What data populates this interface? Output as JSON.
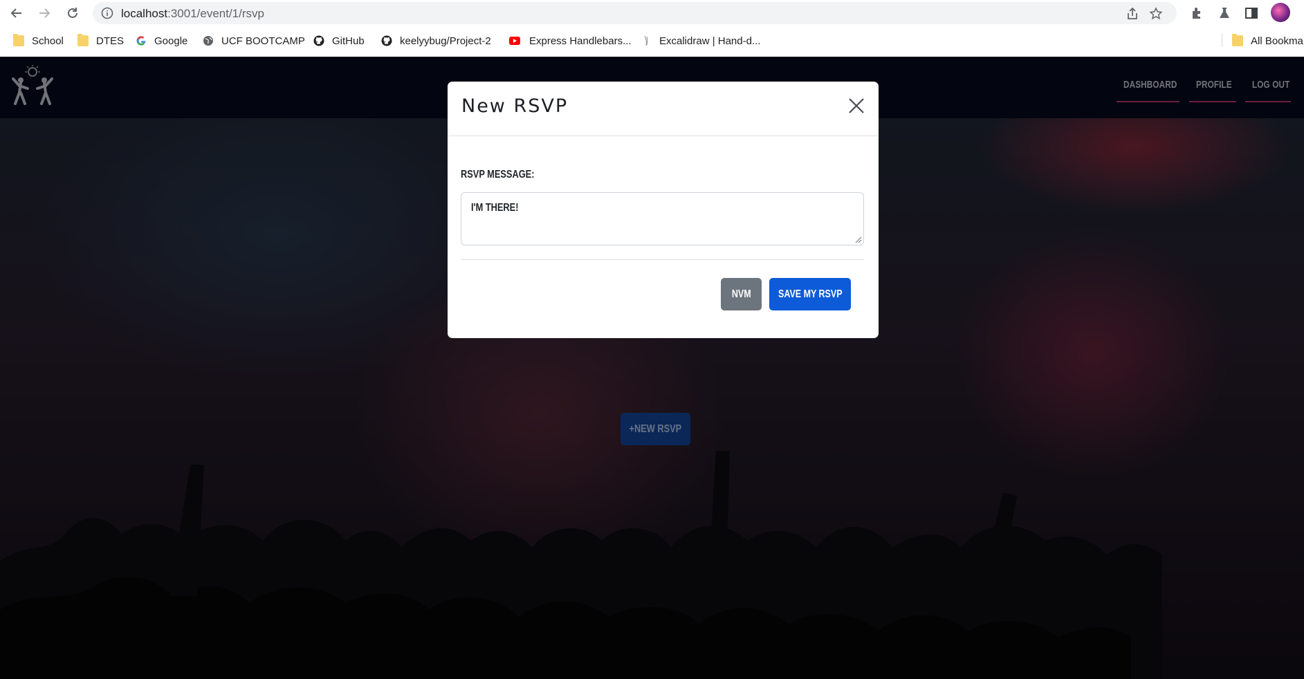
{
  "browser": {
    "url_host": "localhost",
    "url_path": ":3001/event/1/rsvp",
    "bookmarks": [
      {
        "label": "School",
        "icon": "folder-icon"
      },
      {
        "label": "DTES",
        "icon": "folder-icon"
      },
      {
        "label": "Google",
        "icon": "google-icon"
      },
      {
        "label": "UCF BOOTCAMP",
        "icon": "globe-icon"
      },
      {
        "label": "GitHub",
        "icon": "github-icon"
      },
      {
        "label": "keelyybug/Project-2",
        "icon": "github-icon"
      },
      {
        "label": "Express Handlebars...",
        "icon": "youtube-icon"
      },
      {
        "label": "Excalidraw | Hand-d...",
        "icon": "excalidraw-icon"
      }
    ],
    "all_bookmarks": "All Bookma"
  },
  "app": {
    "nav": {
      "dashboard": "DASHBOARD",
      "profile": "PROFILE",
      "logout": "LOG OUT"
    },
    "new_rsvp_button": "+NEW RSVP"
  },
  "modal": {
    "title": "New RSVP",
    "field_label": "RSVP MESSAGE:",
    "message_value": "I'M THERE!",
    "cancel_label": "NVM",
    "save_label": "SAVE MY RSVP"
  },
  "colors": {
    "nav_bg": "#050a1a",
    "primary": "#0d5bd8",
    "secondary": "#6c757d",
    "nav_underline": "#b0306a"
  }
}
